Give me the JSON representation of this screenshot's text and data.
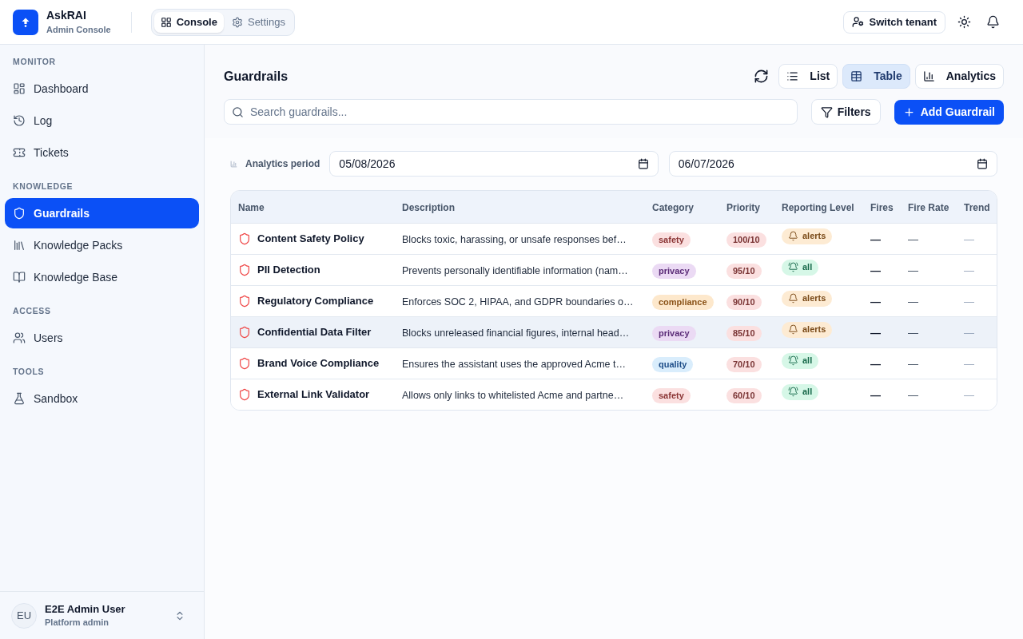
{
  "app": {
    "name": "AskRAI",
    "subtitle": "Admin Console"
  },
  "top_tabs": [
    {
      "label": "Console",
      "selected": true
    },
    {
      "label": "Settings",
      "selected": false
    }
  ],
  "switch_tenant_button": "Switch tenant",
  "sidebar": {
    "sections": [
      {
        "title": "MONITOR",
        "items": [
          {
            "label": "Dashboard",
            "selected": false
          },
          {
            "label": "Log",
            "selected": false
          },
          {
            "label": "Tickets",
            "selected": false
          }
        ]
      },
      {
        "title": "KNOWLEDGE",
        "items": [
          {
            "label": "Guardrails",
            "selected": true
          },
          {
            "label": "Knowledge Packs",
            "selected": false
          },
          {
            "label": "Knowledge Base",
            "selected": false
          }
        ]
      },
      {
        "title": "ACCESS",
        "items": [
          {
            "label": "Users",
            "selected": false
          }
        ]
      },
      {
        "title": "TOOLS",
        "items": [
          {
            "label": "Sandbox",
            "selected": false
          }
        ]
      }
    ],
    "user": {
      "initials": "EU",
      "name": "E2E Admin User",
      "role": "Platform admin"
    }
  },
  "page": {
    "title": "Guardrails",
    "views": [
      {
        "label": "List",
        "selected": false
      },
      {
        "label": "Table",
        "selected": true
      },
      {
        "label": "Analytics",
        "selected": false
      }
    ],
    "search": {
      "placeholder": "Search guardrails..."
    },
    "filters_button": "Filters",
    "add_button": "Add Guardrail",
    "analytics_period": {
      "label": "Analytics period",
      "from": "05/08/2026",
      "to": "06/07/2026"
    }
  },
  "table": {
    "columns": [
      "Name",
      "Description",
      "Category",
      "Priority",
      "Reporting Level",
      "Fires",
      "Fire Rate",
      "Trend"
    ],
    "rows": [
      {
        "name": "Content Safety Policy",
        "description": "Blocks toxic, harassing, or unsafe responses bef…",
        "category": {
          "label": "safety",
          "color": "#fbe0e0"
        },
        "priority": "100/10",
        "reporting": {
          "label": "alerts",
          "kind": "alerts"
        },
        "fires": "—",
        "fire_rate": "—",
        "trend": "—",
        "hovered": false
      },
      {
        "name": "PII Detection",
        "description": "Prevents personally identifiable information (nam…",
        "category": {
          "label": "privacy",
          "color": "#ebdaf4"
        },
        "priority": "95/10",
        "reporting": {
          "label": "all",
          "kind": "all"
        },
        "fires": "—",
        "fire_rate": "—",
        "trend": "—",
        "hovered": false
      },
      {
        "name": "Regulatory Compliance",
        "description": "Enforces SOC 2, HIPAA, and GDPR boundaries o…",
        "category": {
          "label": "compliance",
          "color": "#fde8cc"
        },
        "priority": "90/10",
        "reporting": {
          "label": "alerts",
          "kind": "alerts"
        },
        "fires": "—",
        "fire_rate": "—",
        "trend": "—",
        "hovered": false
      },
      {
        "name": "Confidential Data Filter",
        "description": "Blocks unreleased financial figures, internal head…",
        "category": {
          "label": "privacy",
          "color": "#ebdaf4"
        },
        "priority": "85/10",
        "reporting": {
          "label": "alerts",
          "kind": "alerts"
        },
        "fires": "—",
        "fire_rate": "—",
        "trend": "—",
        "hovered": true
      },
      {
        "name": "Brand Voice Compliance",
        "description": "Ensures the assistant uses the approved Acme t…",
        "category": {
          "label": "quality",
          "color": "#d9edfc"
        },
        "priority": "70/10",
        "reporting": {
          "label": "all",
          "kind": "all"
        },
        "fires": "—",
        "fire_rate": "—",
        "trend": "—",
        "hovered": false
      },
      {
        "name": "External Link Validator",
        "description": "Allows only links to whitelisted Acme and partne…",
        "category": {
          "label": "safety",
          "color": "#fbe0e0"
        },
        "priority": "60/10",
        "reporting": {
          "label": "all",
          "kind": "all"
        },
        "fires": "—",
        "fire_rate": "—",
        "trend": "—",
        "hovered": false
      }
    ]
  }
}
